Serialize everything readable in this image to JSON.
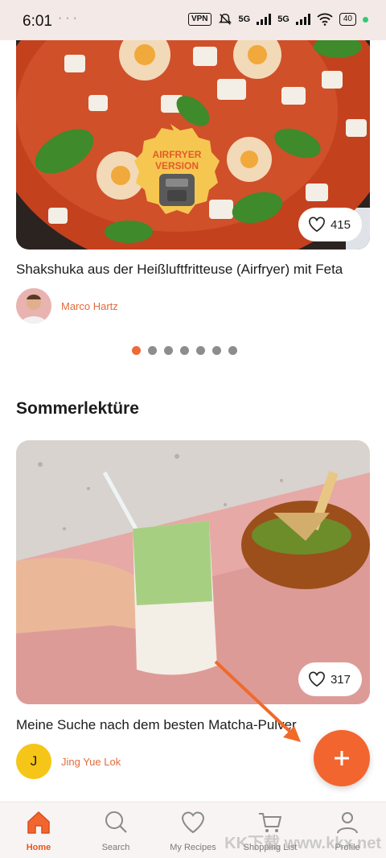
{
  "status_bar": {
    "time": "6:01",
    "dots": "···",
    "vpn": "VPN",
    "net1": "5G",
    "net2": "5G",
    "battery": "40"
  },
  "cards": [
    {
      "title": "Shakshuka aus der Heißluftfritteuse (Airfryer) mit Feta",
      "likes": "415",
      "badge_line1": "AIRFRYER",
      "badge_line2": "VERSION",
      "author": "Marco Hartz"
    },
    {
      "title": "Meine Suche nach dem besten Matcha-Pulver",
      "likes": "317",
      "author": "Jing Yue Lok",
      "author_initial": "J"
    }
  ],
  "carousel": {
    "count": 7,
    "active_index": 0
  },
  "section": {
    "title": "Sommerlektüre"
  },
  "fab": {
    "icon": "plus-icon"
  },
  "nav": [
    {
      "label": "Home",
      "icon": "home-icon",
      "active": true
    },
    {
      "label": "Search",
      "icon": "search-icon",
      "active": false
    },
    {
      "label": "My Recipes",
      "icon": "heart-icon",
      "active": false
    },
    {
      "label": "Shopping List",
      "icon": "cart-icon",
      "active": false
    },
    {
      "label": "Profile",
      "icon": "profile-icon",
      "active": false
    }
  ],
  "colors": {
    "accent": "#f2652f",
    "author": "#e26a3c",
    "active_dot": "#ee6a37",
    "inactive_dot": "#8d8d8d"
  },
  "watermark": "KK下载 www.kkx.net"
}
